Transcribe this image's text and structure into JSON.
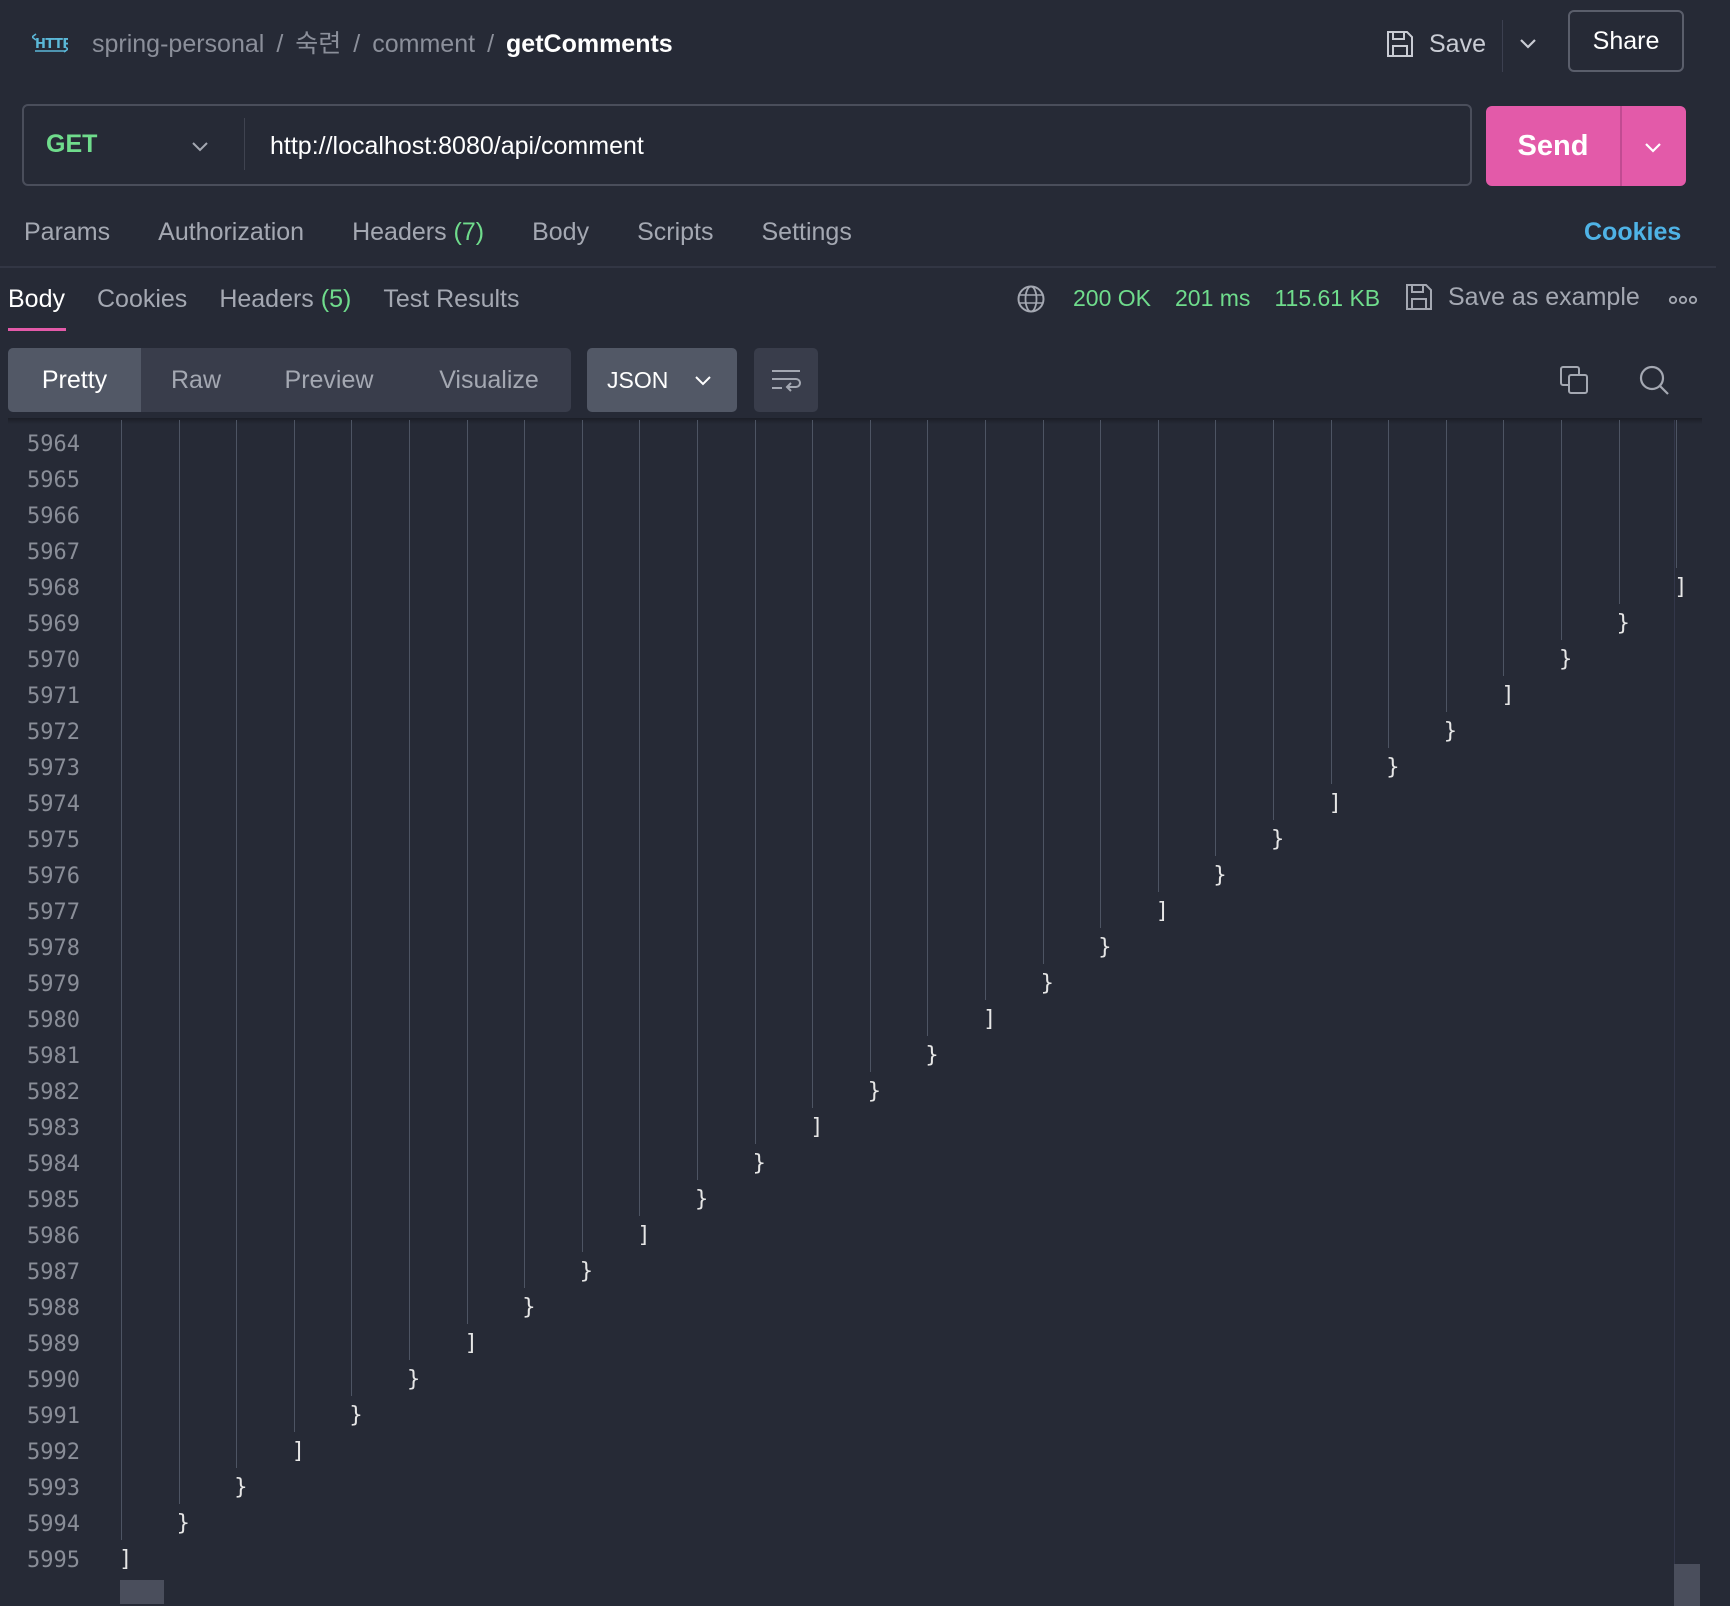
{
  "header": {
    "logo": "HTTP",
    "breadcrumb": [
      "spring-personal",
      "숙련",
      "comment",
      "getComments"
    ],
    "save_label": "Save",
    "share_label": "Share"
  },
  "request": {
    "method": "GET",
    "url": "http://localhost:8080/api/comment",
    "send_label": "Send",
    "tabs": {
      "params": "Params",
      "authorization": "Authorization",
      "headers": "Headers",
      "headers_count": "(7)",
      "body": "Body",
      "scripts": "Scripts",
      "settings": "Settings"
    },
    "cookies_label": "Cookies"
  },
  "response": {
    "tabs": {
      "body": "Body",
      "cookies": "Cookies",
      "headers": "Headers",
      "headers_count": "(5)",
      "test_results": "Test Results"
    },
    "status": "200 OK",
    "time": "201 ms",
    "size": "115.61 KB",
    "save_example_label": "Save as example",
    "view_modes": [
      "Pretty",
      "Raw",
      "Preview",
      "Visualize"
    ],
    "active_view": "Pretty",
    "format": "JSON"
  },
  "editor": {
    "first_line": 5964,
    "lines": [
      {
        "n": "5964",
        "ch": ""
      },
      {
        "n": "5965",
        "ch": ""
      },
      {
        "n": "5966",
        "ch": ""
      },
      {
        "n": "5967",
        "ch": ""
      },
      {
        "n": "5968",
        "ch": "]"
      },
      {
        "n": "5969",
        "ch": "}"
      },
      {
        "n": "5970",
        "ch": "}"
      },
      {
        "n": "5971",
        "ch": "]"
      },
      {
        "n": "5972",
        "ch": "}"
      },
      {
        "n": "5973",
        "ch": "}"
      },
      {
        "n": "5974",
        "ch": "]"
      },
      {
        "n": "5975",
        "ch": "}"
      },
      {
        "n": "5976",
        "ch": "}"
      },
      {
        "n": "5977",
        "ch": "]"
      },
      {
        "n": "5978",
        "ch": "}"
      },
      {
        "n": "5979",
        "ch": "}"
      },
      {
        "n": "5980",
        "ch": "]"
      },
      {
        "n": "5981",
        "ch": "}"
      },
      {
        "n": "5982",
        "ch": "}"
      },
      {
        "n": "5983",
        "ch": "]"
      },
      {
        "n": "5984",
        "ch": "}"
      },
      {
        "n": "5985",
        "ch": "}"
      },
      {
        "n": "5986",
        "ch": "]"
      },
      {
        "n": "5987",
        "ch": "}"
      },
      {
        "n": "5988",
        "ch": "}"
      },
      {
        "n": "5989",
        "ch": "]"
      },
      {
        "n": "5990",
        "ch": "}"
      },
      {
        "n": "5991",
        "ch": "}"
      },
      {
        "n": "5992",
        "ch": "]"
      },
      {
        "n": "5993",
        "ch": "}"
      },
      {
        "n": "5994",
        "ch": "}"
      },
      {
        "n": "5995",
        "ch": "]"
      }
    ]
  },
  "colors": {
    "background": "#262a36",
    "send": "#e35aa9",
    "method": "#6fdc8c",
    "status": "#6fdc8c",
    "cookies_link": "#4fb3e6"
  },
  "icons": [
    "http-logo-icon",
    "save-icon",
    "chevron-down-icon",
    "globe-icon",
    "more-icon",
    "wrap-lines-icon",
    "copy-icon",
    "search-icon"
  ]
}
